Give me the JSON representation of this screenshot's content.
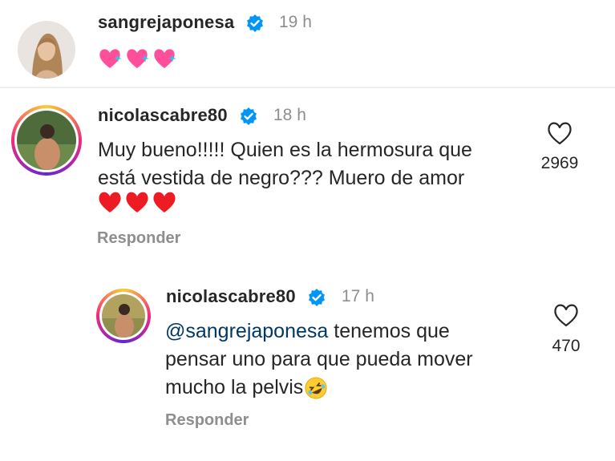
{
  "comments": [
    {
      "username": "sangrejaponesa",
      "time": "19 h",
      "emoji_icons": [
        "sparkling-heart-icon",
        "sparkling-heart-icon",
        "sparkling-heart-icon"
      ]
    },
    {
      "username": "nicolascabre80",
      "time": "18 h",
      "text_line1": "Muy bueno!!!!! Quien es la hermosura que",
      "text_line2": "está vestida de negro??? Muero de amor",
      "emoji_icons": [
        "red-heart-icon",
        "red-heart-icon",
        "red-heart-icon"
      ],
      "reply_label": "Responder",
      "likes": "2969"
    },
    {
      "username": "nicolascabre80",
      "time": "17 h",
      "mention": "@sangrejaponesa",
      "text_line1_rest": " tenemos que",
      "text_line2": "pensar uno para que pueda mover",
      "text_line3": "mucho la pelvis",
      "emoji_icon": "rolling-laughing-icon",
      "reply_label": "Responder",
      "likes": "470"
    }
  ],
  "colors": {
    "verified": "#0095f6",
    "secondary_text": "#8e8e8e",
    "mention": "#00376b",
    "heart_red": "#ed1c24",
    "heart_pink": "#ff4f9b"
  }
}
